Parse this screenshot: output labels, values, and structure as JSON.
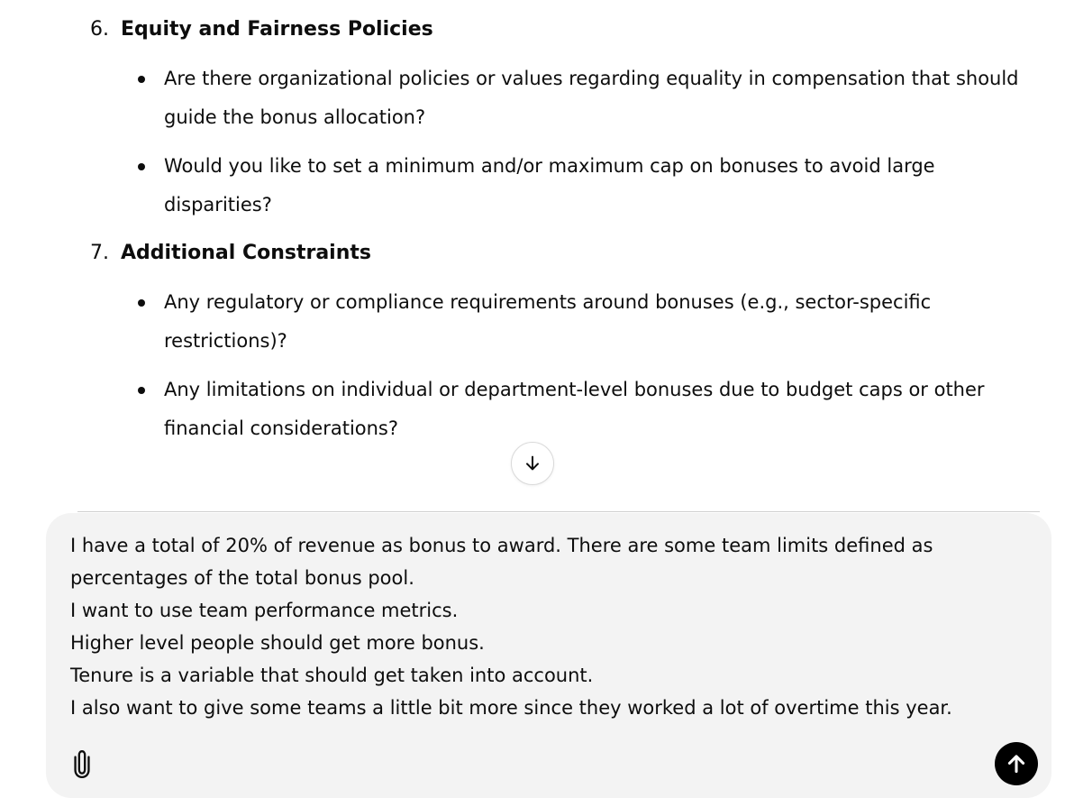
{
  "sections": [
    {
      "number": "6.",
      "title": "Equity and Fairness Policies",
      "bullets": [
        {
          "line1": "Are there organizational policies or values regarding equality in compensation that should",
          "line2": "guide the bonus allocation?"
        },
        {
          "line1": "Would you like to set a minimum and/or maximum cap on bonuses to avoid large",
          "line2": "disparities?"
        }
      ]
    },
    {
      "number": "7.",
      "title": "Additional Constraints",
      "bullets": [
        {
          "line1": "Any regulatory or compliance requirements around bonuses (e.g., sector-specific",
          "line2": "restrictions)?"
        },
        {
          "line1": "Any limitations on individual or department-level bonuses due to budget caps or other",
          "line2": "financial considerations?"
        }
      ]
    }
  ],
  "composer": {
    "lines": [
      "I have a total of 20% of revenue as bonus to award. There are some team limits defined as",
      "percentages of the total bonus pool.",
      "I want to use team performance metrics.",
      "Higher level people should get more bonus.",
      "Tenure is a variable that should get taken into account.",
      "I also want to give some teams a little bit more since they worked a lot of overtime this year."
    ]
  },
  "icons": {
    "scroll_down": "arrow-down-icon",
    "attach": "paperclip-icon",
    "send": "arrow-up-icon"
  },
  "colors": {
    "text": "#0d0d0d",
    "composer_bg": "#f3f3f3",
    "send_bg": "#000000"
  }
}
